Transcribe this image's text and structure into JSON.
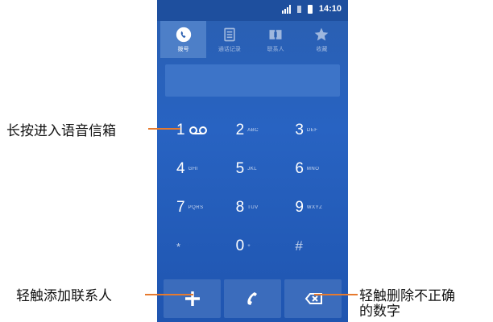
{
  "statusbar": {
    "time": "14:10"
  },
  "tabs": [
    {
      "label": "拨号",
      "icon": "phone-handset-icon"
    },
    {
      "label": "通话记录",
      "icon": "call-log-icon"
    },
    {
      "label": "联系人",
      "icon": "contacts-icon"
    },
    {
      "label": "收藏",
      "icon": "star-icon"
    }
  ],
  "keypad": [
    [
      {
        "digit": "1",
        "letters": ""
      },
      {
        "digit": "2",
        "letters": "ABC"
      },
      {
        "digit": "3",
        "letters": "DEF"
      }
    ],
    [
      {
        "digit": "4",
        "letters": "GHI"
      },
      {
        "digit": "5",
        "letters": "JKL"
      },
      {
        "digit": "6",
        "letters": "MNO"
      }
    ],
    [
      {
        "digit": "7",
        "letters": "PQRS"
      },
      {
        "digit": "8",
        "letters": "TUV"
      },
      {
        "digit": "9",
        "letters": "WXYZ"
      }
    ],
    [
      {
        "digit": "*",
        "letters": ""
      },
      {
        "digit": "0",
        "letters": "+"
      },
      {
        "digit": "#",
        "letters": ""
      }
    ]
  ],
  "actions": {
    "add_contact_icon": "plus-icon",
    "call_icon": "phone-call-icon",
    "delete_icon": "backspace-icon"
  },
  "annotations": {
    "voicemail": "长按进入语音信箱",
    "add_contact": "轻触添加联系人",
    "delete_line1": "轻触删除不正确",
    "delete_line2": "的数字"
  },
  "colors": {
    "phone_bg": "#2863c2",
    "callout": "#e67a2e"
  }
}
